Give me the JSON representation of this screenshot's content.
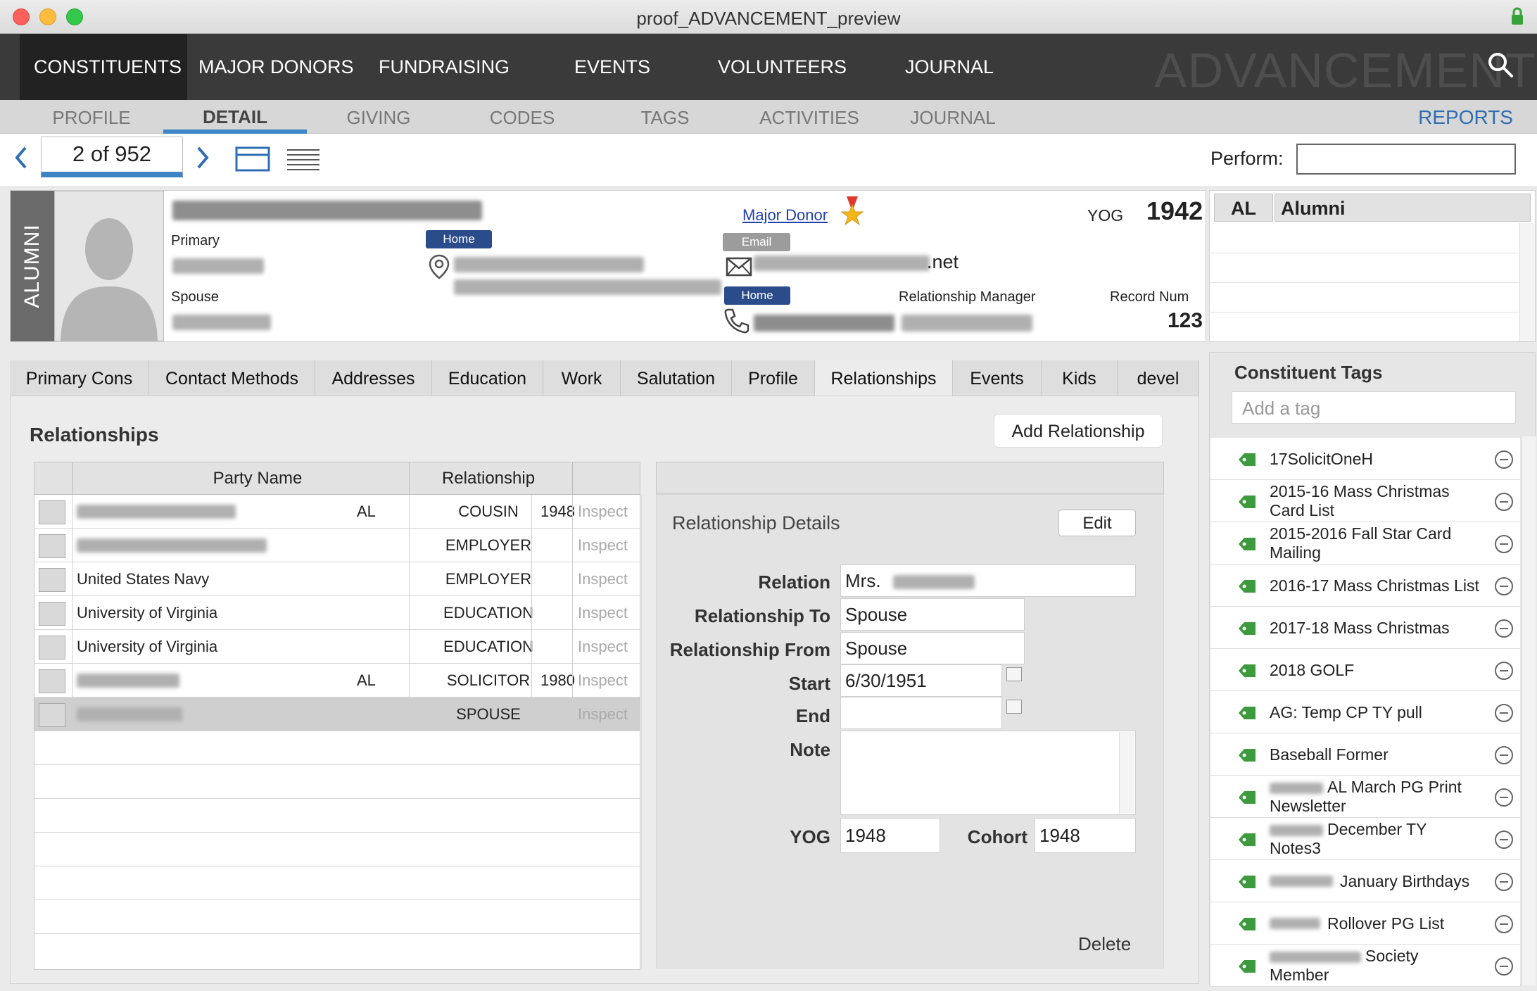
{
  "window": {
    "title": "proof_ADVANCEMENT_preview"
  },
  "main_nav": {
    "items": [
      "CONSTITUENTS",
      "MAJOR DONORS",
      "FUNDRAISING",
      "EVENTS",
      "VOLUNTEERS",
      "JOURNAL"
    ],
    "active": "CONSTITUENTS",
    "brand": "ADVANCEMENT"
  },
  "sub_nav": {
    "items": [
      "PROFILE",
      "DETAIL",
      "GIVING",
      "CODES",
      "TAGS",
      "ACTIVITIES",
      "JOURNAL"
    ],
    "active": "DETAIL",
    "reports": "REPORTS"
  },
  "toolbar": {
    "record_counter": "2 of 952",
    "perform_label": "Perform:",
    "perform_value": ""
  },
  "header": {
    "type_strip": "ALUMNI",
    "primary_label": "Primary",
    "spouse_label": "Spouse",
    "address_badge": "Home",
    "email_badge": "Email",
    "phone_badge": "Home",
    "email_suffix": ".net",
    "major_donor_link": "Major Donor",
    "yog_label": "YOG",
    "yog_value": "1942",
    "relationship_manager_label": "Relationship Manager",
    "record_num_label": "Record Num",
    "record_num_value": "123"
  },
  "code_box": {
    "code": "AL",
    "description": "Alumni"
  },
  "tabs": {
    "items": [
      "Primary Cons",
      "Contact Methods",
      "Addresses",
      "Education",
      "Work",
      "Salutation",
      "Profile",
      "Relationships",
      "Events",
      "Kids",
      "devel"
    ],
    "active": "Relationships"
  },
  "relationships": {
    "title": "Relationships",
    "add_button": "Add Relationship",
    "columns": [
      "Party Name",
      "Relationship"
    ],
    "rows": [
      {
        "party": "",
        "code": "AL",
        "relationship": "COUSIN",
        "year": "1948",
        "action": "Inspect"
      },
      {
        "party": "",
        "code": "",
        "relationship": "EMPLOYER",
        "year": "",
        "action": "Inspect"
      },
      {
        "party": "United States Navy",
        "code": "",
        "relationship": "EMPLOYER",
        "year": "",
        "action": "Inspect"
      },
      {
        "party": "University of Virginia",
        "code": "",
        "relationship": "EDUCATION",
        "year": "",
        "action": "Inspect"
      },
      {
        "party": "University of Virginia",
        "code": "",
        "relationship": "EDUCATION",
        "year": "",
        "action": "Inspect"
      },
      {
        "party": "",
        "code": "AL",
        "relationship": "SOLICITOR",
        "year": "1980",
        "action": "Inspect"
      },
      {
        "party": "",
        "code": "",
        "relationship": "SPOUSE",
        "year": "",
        "action": "Inspect"
      }
    ]
  },
  "details": {
    "title": "Relationship Details",
    "edit_button": "Edit",
    "relation_label": "Relation",
    "relation_value": "Mrs.",
    "to_label": "Relationship To",
    "to_value": "Spouse",
    "from_label": "Relationship From",
    "from_value": "Spouse",
    "start_label": "Start",
    "start_value": "6/30/1951",
    "end_label": "End",
    "end_value": "",
    "note_label": "Note",
    "note_value": "",
    "yog_label": "YOG",
    "yog_value": "1948",
    "cohort_label": "Cohort",
    "cohort_value": "1948",
    "delete_button": "Delete"
  },
  "tags": {
    "title": "Constituent Tags",
    "input_placeholder": "Add a tag",
    "items": [
      "17SolicitOneH",
      "2015-16 Mass Christmas Card List",
      "2015-2016 Fall Star Card Mailing",
      "2016-17 Mass Christmas List",
      "2017-18 Mass Christmas",
      "2018 GOLF",
      "AG: Temp CP TY pull",
      "Baseball Former",
      "AL March PG Print Newsletter",
      "December TY Notes3",
      "January Birthdays",
      "Rollover PG List",
      "Society Member"
    ]
  },
  "colors": {
    "nav_bg": "#3a3a3a",
    "accent_blue": "#3f84c4",
    "badge_blue": "#2b4c8a",
    "tag_green": "#3d9a3d"
  }
}
